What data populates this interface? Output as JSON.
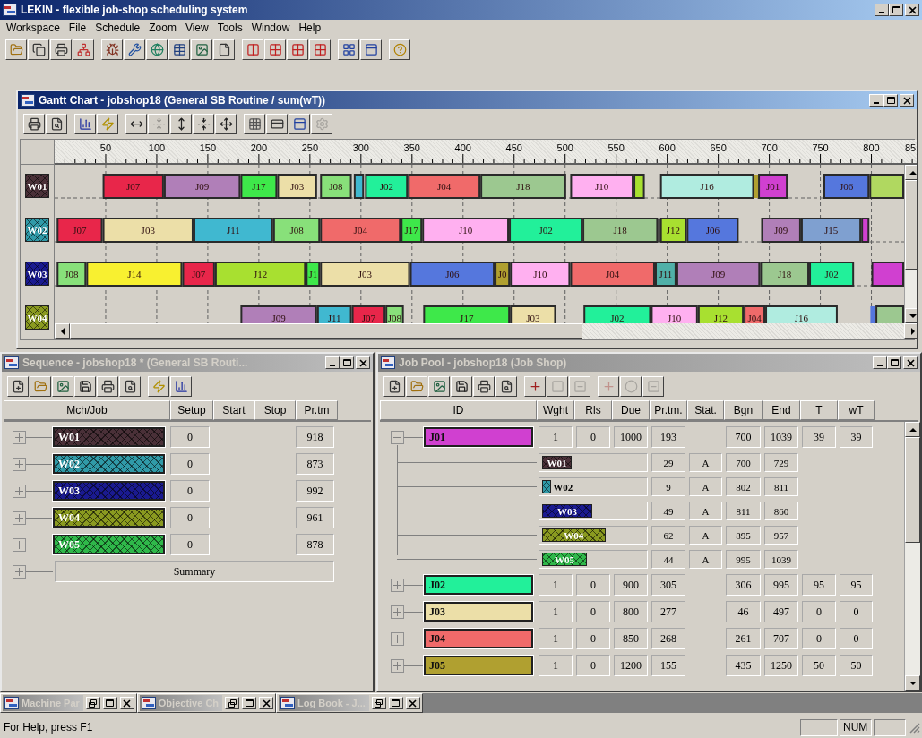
{
  "app": {
    "title": "LEKIN - flexible job-shop scheduling system",
    "active": true
  },
  "menu": [
    "Workspace",
    "File",
    "Schedule",
    "Zoom",
    "View",
    "Tools",
    "Window",
    "Help"
  ],
  "gantt": {
    "title": "Gantt Chart - jobshop18 (General SB Routine / sum(wT))",
    "active": true,
    "toolbar": [
      {
        "disabled": false
      },
      {
        "disabled": false
      },
      {
        "disabled": false
      },
      {
        "disabled": false
      },
      {
        "disabled": false
      },
      {
        "disabled": true
      },
      {
        "disabled": false
      },
      {
        "disabled": false
      },
      {
        "disabled": false
      },
      {
        "disabled": false
      },
      {
        "disabled": false
      },
      {
        "disabled": false
      },
      {
        "disabled": true
      }
    ],
    "ticks": [
      "50",
      "100",
      "150",
      "200",
      "250",
      "300",
      "350",
      "400",
      "450",
      "500",
      "550",
      "600",
      "650",
      "700",
      "750",
      "800",
      "85"
    ],
    "rows": [
      {
        "label": "W01",
        "color": "#4a3038",
        "bars": [
          {
            "job": "J07",
            "color": "#e8264a"
          },
          {
            "job": "J09",
            "color": "#b07fb8"
          },
          {
            "job": "J17",
            "color": "#3ee84a"
          },
          {
            "job": "J03",
            "color": "#ecdfa8"
          },
          {
            "job": "J08",
            "color": "#88e07a"
          },
          {
            "color": "#40b8d0"
          },
          {
            "job": "J02",
            "color": "#22f09a"
          },
          {
            "job": "J04",
            "color": "#f06a6a"
          },
          {
            "job": "J18",
            "color": "#9cc890"
          },
          {
            "job": "J10",
            "color": "#ffb0f0"
          },
          {
            "color": "#a8e030"
          },
          {
            "job": "J16",
            "color": "#b0ece0"
          },
          {
            "color": "#b0a030"
          },
          {
            "job": "J01",
            "color": "#d040d0"
          },
          {
            "job": "J06",
            "color": "#5577dd"
          },
          {
            "color": "#b0d860"
          }
        ]
      },
      {
        "label": "W02",
        "color": "#309aa8",
        "bars": [
          {
            "job": "J07",
            "color": "#e8264a"
          },
          {
            "job": "J03",
            "color": "#ecdfa8"
          },
          {
            "job": "J11",
            "color": "#40b8d0"
          },
          {
            "job": "J08",
            "color": "#88e07a"
          },
          {
            "job": "J04",
            "color": "#f06a6a"
          },
          {
            "job": "J17",
            "color": "#3ee84a"
          },
          {
            "job": "J10",
            "color": "#ffb0f0"
          },
          {
            "job": "J02",
            "color": "#22f09a"
          },
          {
            "job": "J18",
            "color": "#9cc890"
          },
          {
            "color": "#202020"
          },
          {
            "job": "J12",
            "color": "#a8e030"
          },
          {
            "job": "J06",
            "color": "#5577dd"
          },
          {
            "job": "J09",
            "color": "#b07fb8"
          },
          {
            "job": "J15",
            "color": "#7fa0d0"
          },
          {
            "color": "#d040d0"
          }
        ]
      },
      {
        "label": "W03",
        "color": "#1a1a90",
        "bars": [
          {
            "job": "J08",
            "color": "#88e07a"
          },
          {
            "job": "J14",
            "color": "#f8f030"
          },
          {
            "job": "J07",
            "color": "#e8264a"
          },
          {
            "job": "J12",
            "color": "#a8e030"
          },
          {
            "job": "J1",
            "color": "#3ee84a"
          },
          {
            "job": "J03",
            "color": "#ecdfa8"
          },
          {
            "job": "J06",
            "color": "#5577dd"
          },
          {
            "job": "J0",
            "color": "#b0a030"
          },
          {
            "job": "J10",
            "color": "#ffb0f0"
          },
          {
            "job": "J04",
            "color": "#f06a6a"
          },
          {
            "job": "J11",
            "color": "#50b0a8"
          },
          {
            "job": "J09",
            "color": "#b07fb8"
          },
          {
            "job": "J18",
            "color": "#9cc890"
          },
          {
            "job": "J02",
            "color": "#22f09a"
          },
          {
            "color": "#d040d0"
          }
        ]
      },
      {
        "label": "W04",
        "color": "#8a9a20",
        "bars": [
          {
            "job": "J09",
            "color": "#b07fb8"
          },
          {
            "job": "J11",
            "color": "#40b8d0"
          },
          {
            "job": "J07",
            "color": "#e8264a"
          },
          {
            "job": "J08",
            "color": "#88e07a"
          },
          {
            "job": "J17",
            "color": "#3ee84a"
          },
          {
            "job": "J03",
            "color": "#ecdfa8"
          },
          {
            "job": "J02",
            "color": "#22f09a"
          },
          {
            "job": "J10",
            "color": "#ffb0f0"
          },
          {
            "job": "J12",
            "color": "#a8e030"
          },
          {
            "job": "J04",
            "color": "#f06a6a"
          },
          {
            "job": "J16",
            "color": "#b0ece0"
          },
          {
            "color": "#5577dd"
          },
          {
            "color": "#9cc890"
          }
        ]
      }
    ]
  },
  "sequence": {
    "title": "Sequence - jobshop18 * (General SB Routi...",
    "active": false,
    "columns": [
      "Mch/Job",
      "Setup",
      "Start",
      "Stop",
      "Pr.tm"
    ],
    "rows": [
      {
        "machine": "W01",
        "color": "#4a3038",
        "setup": "0",
        "pr_tm": "918",
        "expanded": false
      },
      {
        "machine": "W02",
        "color": "#309aa8",
        "setup": "0",
        "pr_tm": "873",
        "expanded": false
      },
      {
        "machine": "W03",
        "color": "#1a1a90",
        "setup": "0",
        "pr_tm": "992",
        "expanded": false
      },
      {
        "machine": "W04",
        "color": "#8a9a20",
        "setup": "0",
        "pr_tm": "961",
        "expanded": false
      },
      {
        "machine": "W05",
        "color": "#2fb84a",
        "setup": "0",
        "pr_tm": "878",
        "expanded": false
      }
    ],
    "summary": {
      "label": "Summary",
      "expanded": false
    }
  },
  "job_pool": {
    "title": "Job Pool - jobshop18 (Job Shop)",
    "active": false,
    "toolbar": [
      {
        "disabled": false
      },
      {
        "disabled": false
      },
      {
        "disabled": false
      },
      {
        "disabled": false
      },
      {
        "disabled": false
      },
      {
        "disabled": false
      },
      {
        "disabled": false
      },
      {
        "disabled": true
      },
      {
        "disabled": true
      },
      {
        "disabled": true
      },
      {
        "disabled": true
      },
      {
        "disabled": true
      }
    ],
    "columns": [
      "ID",
      "Wght",
      "Rls",
      "Due",
      "Pr.tm.",
      "Stat.",
      "Bgn",
      "End",
      "T",
      "wT"
    ],
    "jobs": [
      {
        "id": "J01",
        "color": "#d040d0",
        "wght": "1",
        "rls": "0",
        "due": "1000",
        "pr_tm": "193",
        "bgn": "700",
        "end": "1039",
        "t": "39",
        "wt": "39",
        "expanded": true,
        "operations": [
          {
            "machine": "W01",
            "color": "#4a3038",
            "pr_tm": "29",
            "stat": "A",
            "bgn": "700",
            "end": "729"
          },
          {
            "machine": "W02",
            "color": "#309aa8",
            "pr_tm": "9",
            "stat": "A",
            "bgn": "802",
            "end": "811"
          },
          {
            "machine": "W03",
            "color": "#1a1a90",
            "pr_tm": "49",
            "stat": "A",
            "bgn": "811",
            "end": "860"
          },
          {
            "machine": "W04",
            "color": "#8a9a20",
            "pr_tm": "62",
            "stat": "A",
            "bgn": "895",
            "end": "957"
          },
          {
            "machine": "W05",
            "color": "#2fb84a",
            "pr_tm": "44",
            "stat": "A",
            "bgn": "995",
            "end": "1039"
          }
        ]
      },
      {
        "id": "J02",
        "color": "#22f09a",
        "wght": "1",
        "rls": "0",
        "due": "900",
        "pr_tm": "305",
        "bgn": "306",
        "end": "995",
        "t": "95",
        "wt": "95",
        "expanded": false
      },
      {
        "id": "J03",
        "color": "#ecdfa8",
        "wght": "1",
        "rls": "0",
        "due": "800",
        "pr_tm": "277",
        "bgn": "46",
        "end": "497",
        "t": "0",
        "wt": "0",
        "expanded": false
      },
      {
        "id": "J04",
        "color": "#f06a6a",
        "wght": "1",
        "rls": "0",
        "due": "850",
        "pr_tm": "268",
        "bgn": "261",
        "end": "707",
        "t": "0",
        "wt": "0",
        "expanded": false
      },
      {
        "id": "J05",
        "color": "#b0a030",
        "wght": "1",
        "rls": "0",
        "due": "1200",
        "pr_tm": "155",
        "bgn": "435",
        "end": "1250",
        "t": "50",
        "wt": "50",
        "expanded": false
      }
    ]
  },
  "minimized_windows": [
    {
      "title": "Machine Par"
    },
    {
      "title": "Objective Ch"
    },
    {
      "title": "Log Book - J..."
    }
  ],
  "status_bar": {
    "text": "For Help, press F1",
    "indicators": [
      "NUM"
    ]
  }
}
